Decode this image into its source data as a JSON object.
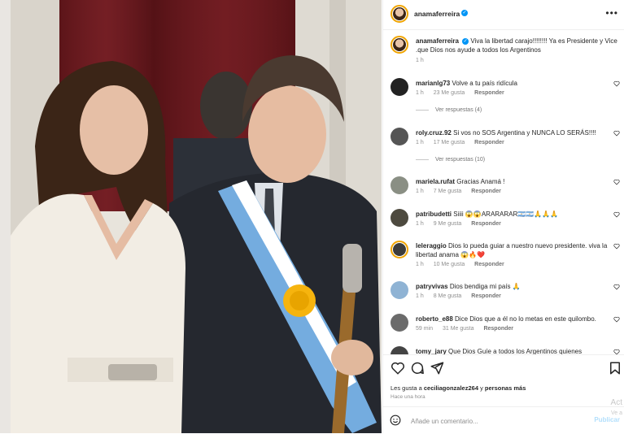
{
  "post": {
    "author": "anamaferreira",
    "caption_user": "anamaferreira",
    "caption_text": "Viva la libertad carajo!!!!!!!! Ya es Presidente y Vice .que Dios nos ayude a todos los Argentinos",
    "caption_time": "1 h"
  },
  "comments": [
    {
      "user": "marianlg73",
      "text": "Volve a tu país ridícula",
      "time": "1 h",
      "likes": "23 Me gusta",
      "reply": "Responder",
      "view_replies": "Ver respuestas (4)"
    },
    {
      "user": "roly.cruz.92",
      "text": "Si vos no SOS Argentina y NUNCA LO SERÁS!!!!",
      "time": "1 h",
      "likes": "17 Me gusta",
      "reply": "Responder",
      "view_replies": "Ver respuestas (10)"
    },
    {
      "user": "mariela.rufat",
      "text": "Gracias Anamá !",
      "time": "1 h",
      "likes": "7 Me gusta",
      "reply": "Responder"
    },
    {
      "user": "patribudetti",
      "text": "Siiii 😱😱ARARARAR🇦🇷🇦🇷🙏🙏🙏",
      "time": "1 h",
      "likes": "9 Me gusta",
      "reply": "Responder"
    },
    {
      "user": "leleraggio",
      "text": "Dios lo pueda guiar a nuestro nuevo presidente. viva la libertad anama 😱🔥❤️",
      "time": "1 h",
      "likes": "10 Me gusta",
      "reply": "Responder"
    },
    {
      "user": "patryvivas",
      "text": "Dios bendiga mi país 🙏",
      "time": "1 h",
      "likes": "8 Me gusta",
      "reply": "Responder"
    },
    {
      "user": "roberto_e88",
      "text": "Dice Dios que a él no lo metas en este quilombo.",
      "time": "59 min",
      "likes": "31 Me gusta",
      "reply": "Responder"
    },
    {
      "user": "tomy_jary",
      "text": "Que Dios Guíe a todos los Argentinos quienes",
      "time": "",
      "likes": "",
      "reply": ""
    }
  ],
  "likes": {
    "prefix": "Les gusta a ",
    "user": "ceciliagonzalez264",
    "middle": " y ",
    "others": "personas más"
  },
  "post_time": "Hace una hora",
  "composer": {
    "placeholder": "Añade un comentario...",
    "publish": "Publicar"
  },
  "ghost": {
    "line1": "Act",
    "line2": "Ve a"
  },
  "colors": {
    "accent": "#0095f6",
    "sash_blue": "#74acdf",
    "sun": "#f6b40e"
  }
}
